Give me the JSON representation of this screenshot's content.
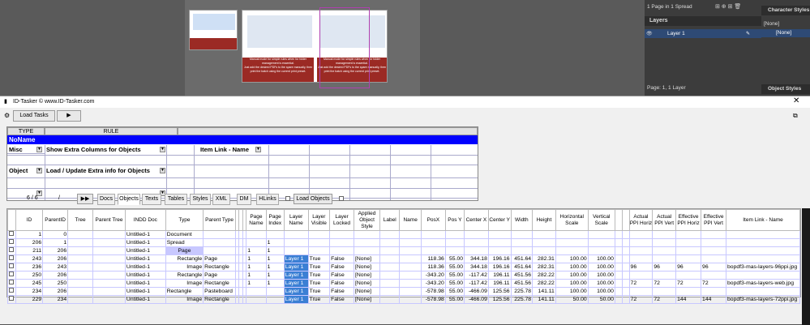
{
  "indesign": {
    "pages_info": "1 Page in 1 Spread",
    "layers_title": "Layers",
    "layer_name": "Layer 1",
    "page_layer_status": "Page: 1, 1 Layer",
    "char_styles_title": "Character Styles",
    "char_style_none": "[None]",
    "char_style_none_sel": "[None]",
    "obj_styles_title": "Object Styles",
    "spread_text_1": "Manual mode for simple rules when for folder management is essential.",
    "spread_text_2": "Just add the desired PDFs to the spare manually, then print the batch using the current print preset.",
    "spread_text_3": "Manual mode for simple rules when for folder management is essential.",
    "spread_text_4": "Just add the desired PDFs to the spare manually, then print the batch using the current print preset."
  },
  "window": {
    "title": "ID-Tasker  © www.ID-Tasker.com",
    "load_tasks": "Load Tasks",
    "play": "▶"
  },
  "rules": {
    "col_type": "TYPE",
    "col_rule": "RULE",
    "noname": "NoName",
    "rows": [
      {
        "type": "Misc",
        "rule": "Show Extra Columns for Objects",
        "extra": "Item Link - Name"
      },
      {
        "type": "Object",
        "rule": "Load / Update Extra info for Objects",
        "extra": ""
      },
      {
        "type": "",
        "rule": "",
        "extra": ""
      }
    ]
  },
  "tabs": {
    "counter": "6 / 6",
    "slash": "/",
    "ff": "▶▶",
    "items": [
      "Docs",
      "Objects",
      "Texts",
      "Tables",
      "Styles",
      "XML",
      "DM",
      "HLinks"
    ],
    "load_objects": "Load Objects"
  },
  "table": {
    "headers": [
      "ID",
      "ParentID",
      "Tree",
      "Parent Tree",
      "INDD Doc",
      "Type",
      "Parent Type",
      "",
      "",
      "",
      "Page Name",
      "Page Index",
      "Layer Name",
      "Layer Visible",
      "Layer Locked",
      "Applied Object Style",
      "Label",
      "Name",
      "PosX",
      "Pos Y",
      "Center X",
      "Center Y",
      "Width",
      "Height",
      "Horizontal Scale",
      "Vertical Scale",
      "",
      "",
      "Actual PPI Horiz",
      "Actual PPI Vert",
      "Effective PPI Horiz",
      "Effective PPI Vert",
      "Item Link - Name"
    ],
    "rows": [
      [
        "1",
        "0",
        "",
        "",
        "Untitled-1",
        "Document",
        "",
        "",
        "",
        "",
        "",
        "",
        "",
        "",
        "",
        "",
        "",
        "",
        "",
        "",
        "",
        "",
        "",
        "",
        "",
        "",
        "",
        "",
        "",
        "",
        "",
        "",
        ""
      ],
      [
        "206",
        "1",
        "",
        "",
        "Untitled-1",
        "Spread",
        "",
        "",
        "",
        "",
        "",
        "1",
        "",
        "",
        "",
        "",
        "",
        "",
        "",
        "",
        "",
        "",
        "",
        "",
        "",
        "",
        "",
        "",
        "",
        "",
        "",
        "",
        ""
      ],
      [
        "211",
        "206",
        "",
        "",
        "Untitled-1",
        "Page",
        "",
        "",
        "",
        "",
        "1",
        "1",
        "",
        "",
        "",
        "",
        "",
        "",
        "",
        "",
        "",
        "",
        "",
        "",
        "",
        "",
        "",
        "",
        "",
        "",
        "",
        "",
        ""
      ],
      [
        "243",
        "206",
        "",
        "",
        "Untitled-1",
        "Rectangle",
        "Page",
        "",
        "",
        "",
        "1",
        "1",
        "Layer 1",
        "True",
        "False",
        "[None]",
        "",
        "",
        "118.36",
        "55.00",
        "344.18",
        "196.16",
        "451.64",
        "282.31",
        "100.00",
        "100.00",
        "",
        "",
        "",
        "",
        "",
        "",
        ""
      ],
      [
        "236",
        "243",
        "",
        "",
        "Untitled-1",
        "Image",
        "Rectangle",
        "",
        "",
        "",
        "1",
        "1",
        "Layer 1",
        "True",
        "False",
        "[None]",
        "",
        "",
        "118.36",
        "55.00",
        "344.18",
        "196.16",
        "451.64",
        "282.31",
        "100.00",
        "100.00",
        "",
        "",
        "96",
        "96",
        "96",
        "96",
        "bopdf3-mas-layers-96ppi.jpg"
      ],
      [
        "250",
        "206",
        "",
        "",
        "Untitled-1",
        "Rectangle",
        "Page",
        "",
        "",
        "",
        "1",
        "1",
        "Layer 1",
        "True",
        "False",
        "[None]",
        "",
        "",
        "-343.20",
        "55.00",
        "-117.42",
        "196.11",
        "451.56",
        "282.22",
        "100.00",
        "100.00",
        "",
        "",
        "",
        "",
        "",
        "",
        ""
      ],
      [
        "245",
        "250",
        "",
        "",
        "Untitled-1",
        "Image",
        "Rectangle",
        "",
        "",
        "",
        "1",
        "1",
        "Layer 1",
        "True",
        "False",
        "[None]",
        "",
        "",
        "-343.20",
        "55.00",
        "-117.42",
        "196.11",
        "451.56",
        "282.22",
        "100.00",
        "100.00",
        "",
        "",
        "72",
        "72",
        "72",
        "72",
        "bopdf3-mas-layers-web.jpg"
      ],
      [
        "234",
        "206",
        "",
        "",
        "Untitled-1",
        "Rectangle",
        "Pasteboard",
        "",
        "",
        "",
        "",
        "",
        "Layer 1",
        "True",
        "False",
        "[None]",
        "",
        "",
        "-578.98",
        "55.00",
        "-466.09",
        "125.56",
        "225.78",
        "141.11",
        "100.00",
        "100.00",
        "",
        "",
        "",
        "",
        "",
        "",
        ""
      ],
      [
        "229",
        "234",
        "",
        "",
        "Untitled-1",
        "Image",
        "Rectangle",
        "",
        "",
        "",
        "",
        "",
        "Layer 1",
        "True",
        "False",
        "[None]",
        "",
        "",
        "-578.98",
        "55.00",
        "-466.09",
        "125.56",
        "225.78",
        "141.11",
        "50.00",
        "50.00",
        "",
        "",
        "72",
        "72",
        "144",
        "144",
        "bopdf3-mas-layers-72ppi.jpg"
      ]
    ]
  },
  "colors": {
    "noname_bg": "#0000ff",
    "layer_highlight": "#3b7fd4",
    "page_highlight": "#c8c8ff",
    "indesign_bg": "#535353",
    "panel_bg": "#3c3c3c"
  }
}
